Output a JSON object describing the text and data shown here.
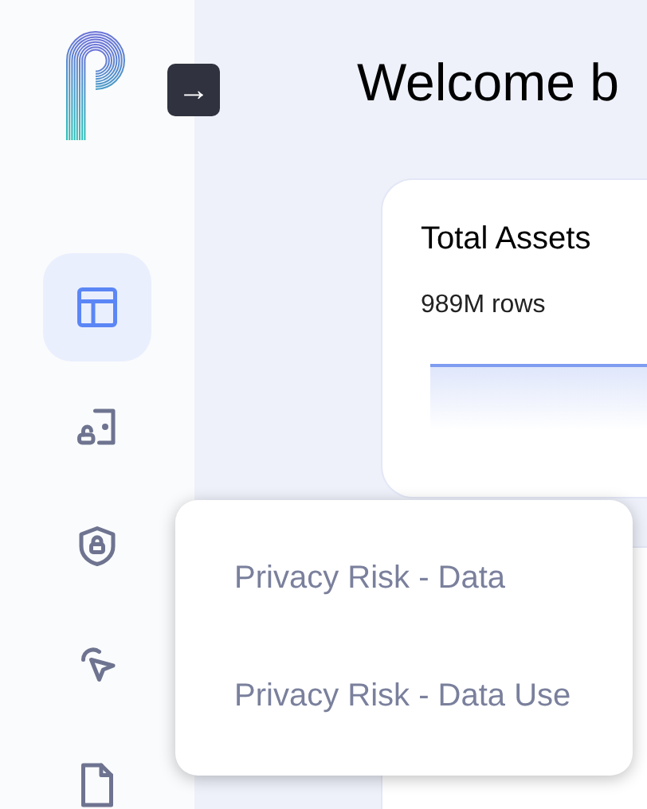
{
  "sidebar": {
    "expand_button": "→",
    "nav_items": [
      {
        "kind": "table",
        "selected": true
      },
      {
        "kind": "lock-box",
        "selected": false
      },
      {
        "kind": "shield",
        "selected": false
      },
      {
        "kind": "pointer",
        "selected": false
      },
      {
        "kind": "file",
        "selected": false
      }
    ]
  },
  "main": {
    "title": "Welcome b",
    "card": {
      "title": "Total Assets",
      "subtitle": "989M rows"
    }
  },
  "popup_menu": {
    "items": [
      {
        "label": "Privacy Risk - Data"
      },
      {
        "label": "Privacy Risk - Data Use"
      }
    ]
  }
}
